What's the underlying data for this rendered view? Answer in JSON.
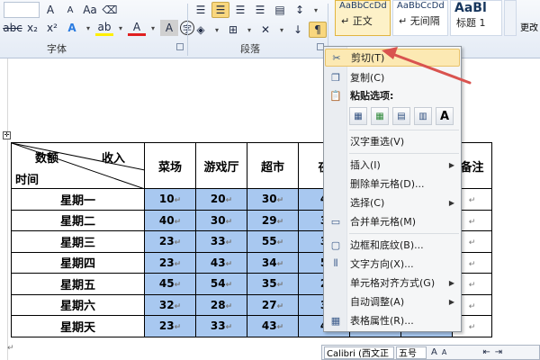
{
  "ribbon": {
    "font_group_label": "字体",
    "paragraph_group_label": "段落",
    "font_buttons": [
      "x₂",
      "x²",
      "Aa",
      "A",
      "ab",
      "A",
      "A",
      "A"
    ],
    "styles": [
      {
        "preview": "AaBbCcDd",
        "name": "↵ 正文",
        "selected": true
      },
      {
        "preview": "AaBbCcDd",
        "name": "↵ 无间隔",
        "selected": false
      },
      {
        "preview": "AaBl",
        "name": "标题 1",
        "selected": false
      }
    ],
    "change_styles_label": "更改"
  },
  "table": {
    "diag_header": {
      "top_left": "数额",
      "top_right": "收入",
      "bottom_left": "时间"
    },
    "columns": [
      "菜场",
      "游戏厅",
      "超市",
      "夜",
      "",
      "",
      "备注"
    ],
    "rows": [
      {
        "day": "星期一",
        "values": [
          "10",
          "20",
          "30",
          "4"
        ]
      },
      {
        "day": "星期二",
        "values": [
          "40",
          "30",
          "29",
          "3"
        ]
      },
      {
        "day": "星期三",
        "values": [
          "23",
          "33",
          "55",
          "3"
        ]
      },
      {
        "day": "星期四",
        "values": [
          "23",
          "43",
          "34",
          "5"
        ]
      },
      {
        "day": "星期五",
        "values": [
          "45",
          "54",
          "35",
          "2"
        ]
      },
      {
        "day": "星期六",
        "values": [
          "32",
          "28",
          "27",
          "3"
        ]
      },
      {
        "day": "星期天",
        "values": [
          "23",
          "33",
          "43",
          "4"
        ]
      }
    ],
    "cell_mark": "↵"
  },
  "context_menu": {
    "cut": "剪切(T)",
    "copy": "复制(C)",
    "paste_options": "粘贴选项:",
    "paste_icons": [
      "keep-source-formatting-icon",
      "merge-table-icon",
      "nest-table-icon",
      "overwrite-cells-icon",
      "keep-text-only-icon"
    ],
    "paste_text_only_glyph": "A",
    "reconvert": "汉字重选(V)",
    "insert": "插入(I)",
    "delete_cells": "删除单元格(D)...",
    "select": "选择(C)",
    "merge_cells": "合并单元格(M)",
    "borders_shading": "边框和底纹(B)...",
    "text_direction": "文字方向(X)...",
    "cell_alignment": "单元格对齐方式(G)",
    "autofit": "自动调整(A)",
    "table_properties": "表格属性(R)..."
  },
  "mini_toolbar": {
    "font": "Calibri (西文正",
    "size": "五号",
    "buttons": [
      "A",
      "A",
      "⇤",
      "⇥"
    ]
  },
  "colors": {
    "highlight_cells": "#a8c8f0",
    "menu_highlight": "#fce9b3",
    "annotation_arrow": "#d9534f"
  }
}
